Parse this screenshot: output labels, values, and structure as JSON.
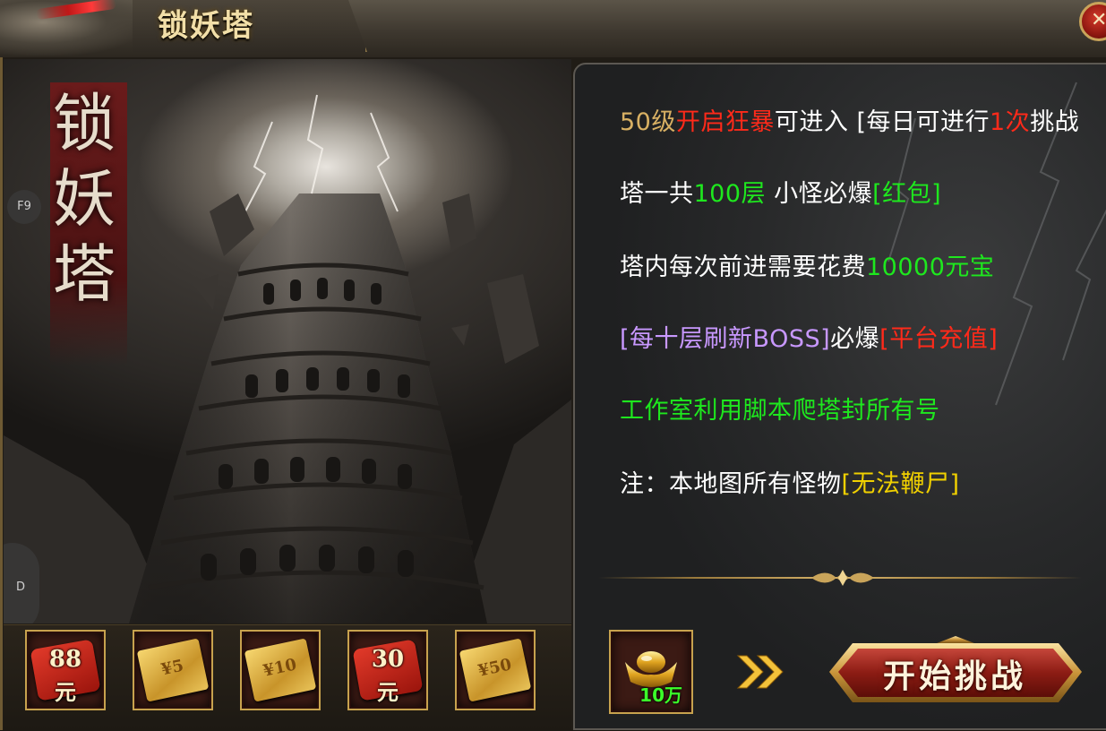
{
  "window": {
    "title": "锁妖塔",
    "close_label": "✕"
  },
  "hotkeys": [
    "F9",
    "D"
  ],
  "art": {
    "seal_chars": [
      "锁",
      "妖",
      "塔"
    ]
  },
  "rewards": [
    {
      "type": "red-packet",
      "label_top": "88",
      "label_bottom": "元"
    },
    {
      "type": "voucher",
      "label": "¥5"
    },
    {
      "type": "voucher",
      "label": "¥10"
    },
    {
      "type": "red-packet",
      "label_top": "30",
      "label_bottom": "元"
    },
    {
      "type": "voucher",
      "label": "¥50"
    }
  ],
  "info": {
    "line1": {
      "level": "50级",
      "berserk": "开启狂暴",
      "enter": "可进入",
      "bracket_open": "[每日可进行",
      "count": "1次",
      "challenge": "挑战"
    },
    "line2": {
      "prefix": "塔一共",
      "floors": "100层",
      "middle": "小怪必爆",
      "reward": "[红包]"
    },
    "line3": {
      "prefix": "塔内每次前进需要花费",
      "cost": "10000元宝"
    },
    "line4": {
      "boss": "[每十层刷新BOSS]",
      "middle": "必爆",
      "reward": "[平台充值]"
    },
    "line5": {
      "text": "工作室利用脚本爬塔封所有号"
    },
    "line6": {
      "prefix": "注：本地图所有怪物",
      "note": "[无法鞭尸]"
    }
  },
  "cost_item": {
    "icon": "gold-ingot-icon",
    "quantity": "10万"
  },
  "action": {
    "label": "开始挑战"
  },
  "colors": {
    "gold": "#d8b063",
    "red": "#ff2a1a",
    "green": "#1ee81e",
    "purple": "#c898ff",
    "yellow": "#f0d000"
  }
}
